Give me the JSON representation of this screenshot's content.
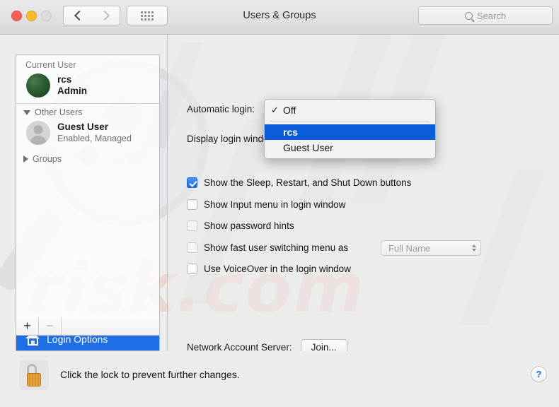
{
  "window": {
    "title": "Users & Groups",
    "traffic_lights": [
      "close-button",
      "minimize-button",
      "zoom-button"
    ],
    "back_label": "‹",
    "forward_label": "›"
  },
  "search": {
    "placeholder": "Search",
    "value": ""
  },
  "sidebar": {
    "current_user_header": "Current User",
    "current_user": {
      "name": "rcs",
      "role": "Admin"
    },
    "other_users_header": "Other Users",
    "other_users": [
      {
        "name": "Guest User",
        "status": "Enabled, Managed"
      }
    ],
    "groups_header": "Groups",
    "login_options_label": "Login Options",
    "add_label": "+",
    "remove_label": "−"
  },
  "main": {
    "automatic_login_label": "Automatic login:",
    "automatic_login_value": "Off",
    "display_login_label": "Display login window as:",
    "display_login_value": "",
    "checkboxes": [
      {
        "label": "Show the Sleep, Restart, and Shut Down buttons",
        "checked": true,
        "enabled": true
      },
      {
        "label": "Show Input menu in login window",
        "checked": false,
        "enabled": true
      },
      {
        "label": "Show password hints",
        "checked": false,
        "enabled": false
      },
      {
        "label": "Show fast user switching menu as",
        "checked": false,
        "enabled": false
      },
      {
        "label": "Use VoiceOver in the login window",
        "checked": false,
        "enabled": true
      }
    ],
    "fast_user_switching_value": "Full Name",
    "network_account_server_label": "Network Account Server:",
    "join_button_label": "Join..."
  },
  "dropdown": {
    "open": true,
    "check_glyph": "✓",
    "items": [
      {
        "label": "Off",
        "checked": true,
        "highlighted": false
      },
      {
        "label": "rcs",
        "checked": false,
        "highlighted": true
      },
      {
        "label": "Guest User",
        "checked": false,
        "highlighted": false
      }
    ]
  },
  "footer": {
    "lock_text": "Click the lock to prevent further changes.",
    "help_label": "?"
  },
  "colors": {
    "accent_blue": "#1e6ee6",
    "menu_highlight": "#0a5cdb",
    "checkbox_blue": "#1a6ae8",
    "window_bg": "#ececec"
  },
  "watermark": {
    "text": "risk.com"
  }
}
